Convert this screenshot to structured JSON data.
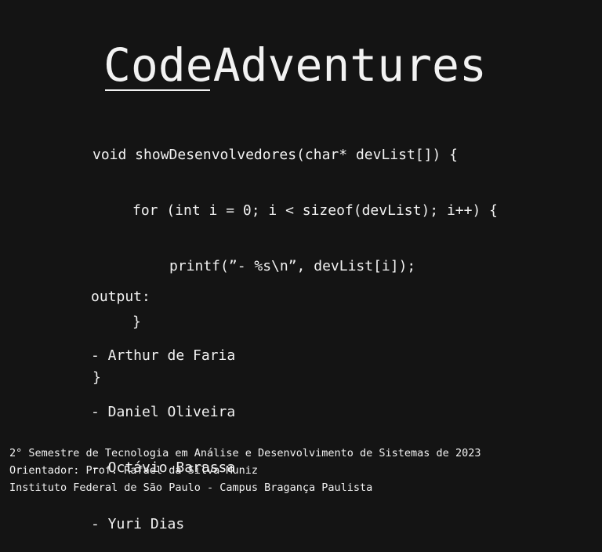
{
  "logo": {
    "part1": "Code",
    "part2": "Adventures"
  },
  "code_lines": [
    "void showDesenvolvedores(char* devList[]) {",
    "for (int i = 0; i < sizeof(devList); i++) {",
    "printf(”- %s\\n”, devList[i]);",
    "}",
    "}"
  ],
  "output": {
    "label": "output:",
    "items": [
      "- Arthur de Faria",
      "- Daniel Oliveira",
      "- Octávio Barassa",
      "- Yuri Dias"
    ]
  },
  "footer": {
    "line1": "2° Semestre de Tecnologia em Análise e Desenvolvimento de Sistemas de 2023",
    "line2": "Orientador: Prof. Rafael da Silva Muniz",
    "line3": "Instituto Federal de São Paulo - Campus Bragança Paulista"
  }
}
